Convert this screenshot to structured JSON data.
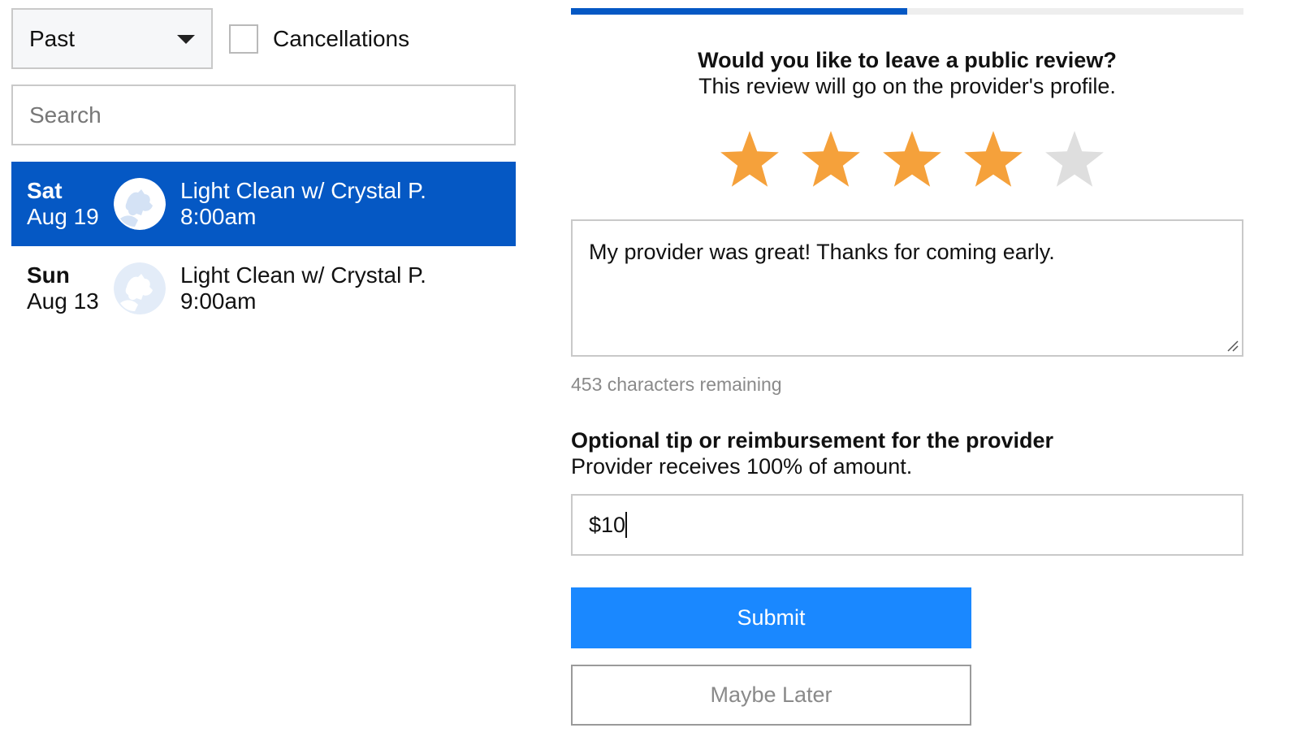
{
  "filters": {
    "period_selected": "Past",
    "cancellations_label": "Cancellations",
    "cancellations_checked": false
  },
  "search": {
    "placeholder": "Search",
    "value": ""
  },
  "appointments": [
    {
      "day": "Sat",
      "date": "Aug 19",
      "title": "Light Clean w/ Crystal P.",
      "time": "8:00am",
      "selected": true
    },
    {
      "day": "Sun",
      "date": "Aug 13",
      "title": "Light Clean w/ Crystal P.",
      "time": "9:00am",
      "selected": false
    }
  ],
  "review": {
    "progress_percent": 50,
    "question": "Would you like to leave a public review?",
    "subtitle": "This review will go on the provider's profile.",
    "rating": 4,
    "max_rating": 5,
    "text": "My provider was great! Thanks for coming early.",
    "chars_remaining": "453 characters remaining"
  },
  "tip": {
    "heading": "Optional tip or reimbursement for the provider",
    "subtitle": "Provider receives 100% of amount.",
    "value": "$10"
  },
  "buttons": {
    "submit_label": "Submit",
    "later_label": "Maybe Later"
  },
  "colors": {
    "accent": "#0558c4",
    "button": "#1a88ff",
    "star_on": "#f5a13b",
    "star_off": "#dedede"
  }
}
